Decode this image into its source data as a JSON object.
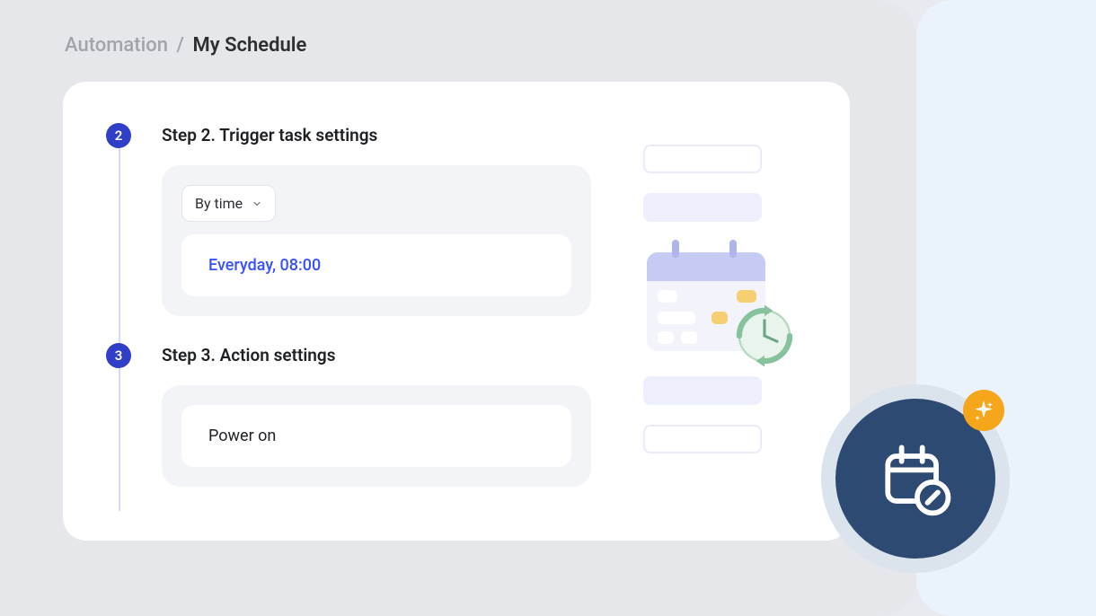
{
  "breadcrumb": {
    "parent": "Automation",
    "separator": "/",
    "current": "My Schedule"
  },
  "steps": [
    {
      "number": "2",
      "title": "Step 2. Trigger task settings",
      "dropdown_label": "By time",
      "value_text": "Everyday,  08:00"
    },
    {
      "number": "3",
      "title": "Step 3. Action settings",
      "value_text": "Power on"
    }
  ],
  "colors": {
    "accent_blue": "#3751ff",
    "step_circle": "#2f3fc8",
    "fab_bg": "#2d4a73",
    "sparkle": "#f5a61b"
  },
  "icons": {
    "chevron_down": "chevron-down-icon",
    "calendar_preview": "calendar-preview-icon",
    "clock_refresh": "clock-refresh-icon",
    "fab_calendar_edit": "calendar-edit-icon",
    "sparkle": "sparkle-icon"
  }
}
